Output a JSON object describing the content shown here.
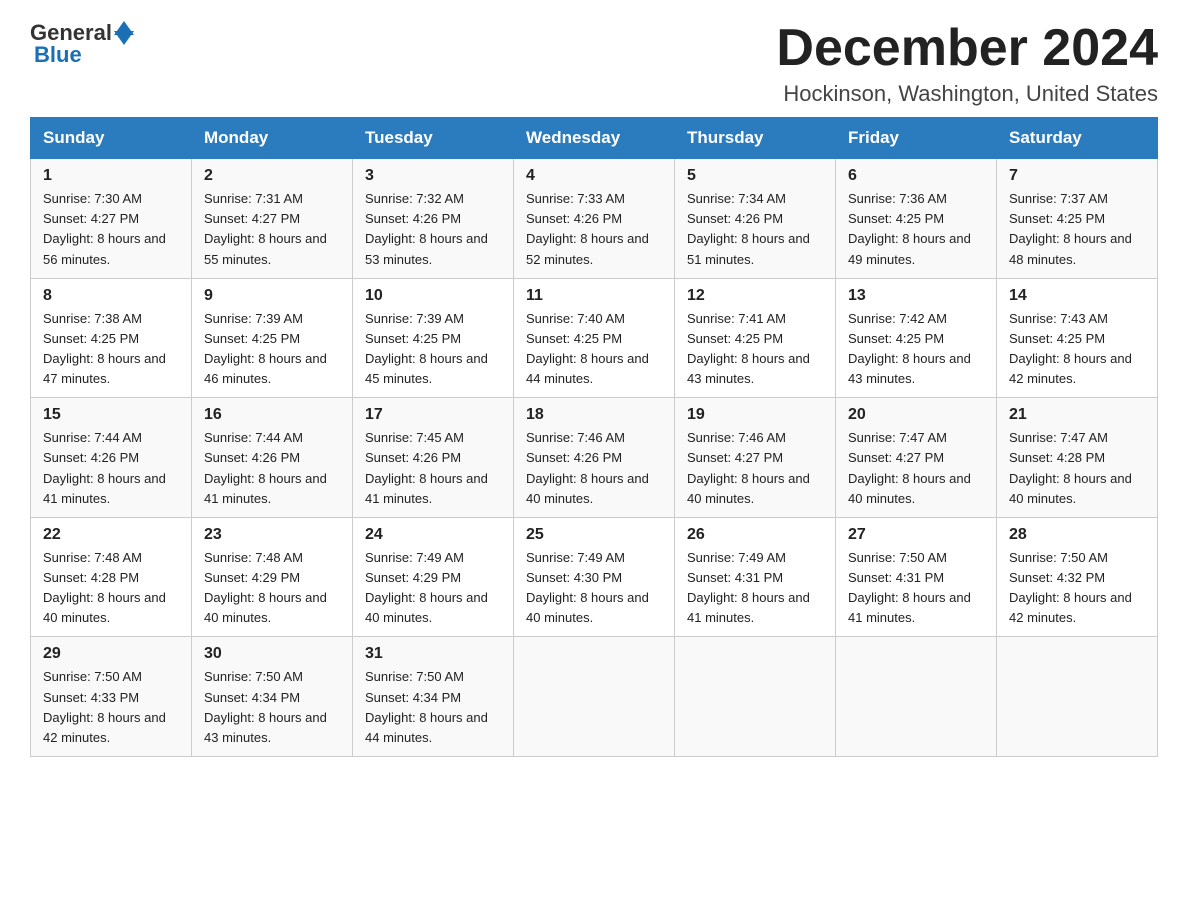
{
  "header": {
    "logo_general": "General",
    "logo_blue": "Blue",
    "month_title": "December 2024",
    "location": "Hockinson, Washington, United States"
  },
  "columns": [
    "Sunday",
    "Monday",
    "Tuesday",
    "Wednesday",
    "Thursday",
    "Friday",
    "Saturday"
  ],
  "weeks": [
    [
      {
        "day": "1",
        "sunrise": "7:30 AM",
        "sunset": "4:27 PM",
        "daylight": "8 hours and 56 minutes."
      },
      {
        "day": "2",
        "sunrise": "7:31 AM",
        "sunset": "4:27 PM",
        "daylight": "8 hours and 55 minutes."
      },
      {
        "day": "3",
        "sunrise": "7:32 AM",
        "sunset": "4:26 PM",
        "daylight": "8 hours and 53 minutes."
      },
      {
        "day": "4",
        "sunrise": "7:33 AM",
        "sunset": "4:26 PM",
        "daylight": "8 hours and 52 minutes."
      },
      {
        "day": "5",
        "sunrise": "7:34 AM",
        "sunset": "4:26 PM",
        "daylight": "8 hours and 51 minutes."
      },
      {
        "day": "6",
        "sunrise": "7:36 AM",
        "sunset": "4:25 PM",
        "daylight": "8 hours and 49 minutes."
      },
      {
        "day": "7",
        "sunrise": "7:37 AM",
        "sunset": "4:25 PM",
        "daylight": "8 hours and 48 minutes."
      }
    ],
    [
      {
        "day": "8",
        "sunrise": "7:38 AM",
        "sunset": "4:25 PM",
        "daylight": "8 hours and 47 minutes."
      },
      {
        "day": "9",
        "sunrise": "7:39 AM",
        "sunset": "4:25 PM",
        "daylight": "8 hours and 46 minutes."
      },
      {
        "day": "10",
        "sunrise": "7:39 AM",
        "sunset": "4:25 PM",
        "daylight": "8 hours and 45 minutes."
      },
      {
        "day": "11",
        "sunrise": "7:40 AM",
        "sunset": "4:25 PM",
        "daylight": "8 hours and 44 minutes."
      },
      {
        "day": "12",
        "sunrise": "7:41 AM",
        "sunset": "4:25 PM",
        "daylight": "8 hours and 43 minutes."
      },
      {
        "day": "13",
        "sunrise": "7:42 AM",
        "sunset": "4:25 PM",
        "daylight": "8 hours and 43 minutes."
      },
      {
        "day": "14",
        "sunrise": "7:43 AM",
        "sunset": "4:25 PM",
        "daylight": "8 hours and 42 minutes."
      }
    ],
    [
      {
        "day": "15",
        "sunrise": "7:44 AM",
        "sunset": "4:26 PM",
        "daylight": "8 hours and 41 minutes."
      },
      {
        "day": "16",
        "sunrise": "7:44 AM",
        "sunset": "4:26 PM",
        "daylight": "8 hours and 41 minutes."
      },
      {
        "day": "17",
        "sunrise": "7:45 AM",
        "sunset": "4:26 PM",
        "daylight": "8 hours and 41 minutes."
      },
      {
        "day": "18",
        "sunrise": "7:46 AM",
        "sunset": "4:26 PM",
        "daylight": "8 hours and 40 minutes."
      },
      {
        "day": "19",
        "sunrise": "7:46 AM",
        "sunset": "4:27 PM",
        "daylight": "8 hours and 40 minutes."
      },
      {
        "day": "20",
        "sunrise": "7:47 AM",
        "sunset": "4:27 PM",
        "daylight": "8 hours and 40 minutes."
      },
      {
        "day": "21",
        "sunrise": "7:47 AM",
        "sunset": "4:28 PM",
        "daylight": "8 hours and 40 minutes."
      }
    ],
    [
      {
        "day": "22",
        "sunrise": "7:48 AM",
        "sunset": "4:28 PM",
        "daylight": "8 hours and 40 minutes."
      },
      {
        "day": "23",
        "sunrise": "7:48 AM",
        "sunset": "4:29 PM",
        "daylight": "8 hours and 40 minutes."
      },
      {
        "day": "24",
        "sunrise": "7:49 AM",
        "sunset": "4:29 PM",
        "daylight": "8 hours and 40 minutes."
      },
      {
        "day": "25",
        "sunrise": "7:49 AM",
        "sunset": "4:30 PM",
        "daylight": "8 hours and 40 minutes."
      },
      {
        "day": "26",
        "sunrise": "7:49 AM",
        "sunset": "4:31 PM",
        "daylight": "8 hours and 41 minutes."
      },
      {
        "day": "27",
        "sunrise": "7:50 AM",
        "sunset": "4:31 PM",
        "daylight": "8 hours and 41 minutes."
      },
      {
        "day": "28",
        "sunrise": "7:50 AM",
        "sunset": "4:32 PM",
        "daylight": "8 hours and 42 minutes."
      }
    ],
    [
      {
        "day": "29",
        "sunrise": "7:50 AM",
        "sunset": "4:33 PM",
        "daylight": "8 hours and 42 minutes."
      },
      {
        "day": "30",
        "sunrise": "7:50 AM",
        "sunset": "4:34 PM",
        "daylight": "8 hours and 43 minutes."
      },
      {
        "day": "31",
        "sunrise": "7:50 AM",
        "sunset": "4:34 PM",
        "daylight": "8 hours and 44 minutes."
      },
      null,
      null,
      null,
      null
    ]
  ]
}
